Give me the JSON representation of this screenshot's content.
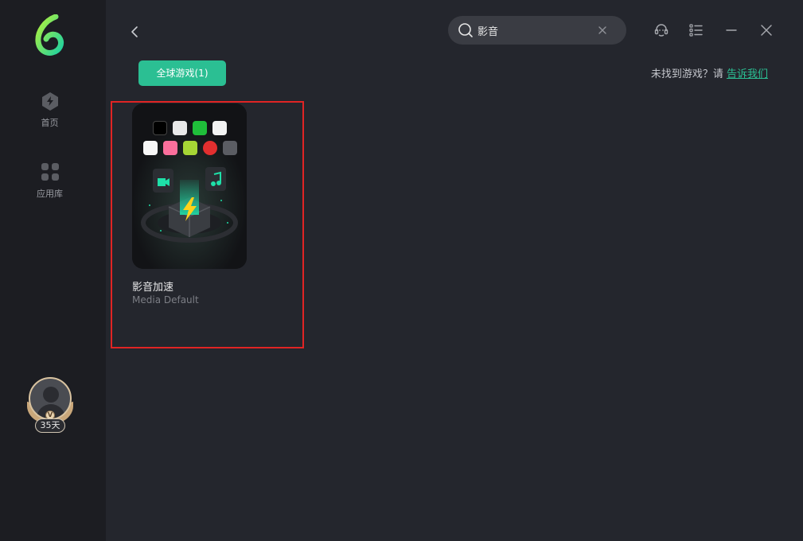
{
  "sidebar": {
    "items": [
      {
        "label": "首页"
      },
      {
        "label": "应用库"
      }
    ],
    "user": {
      "days": "35天",
      "vip_mark": "V"
    }
  },
  "search": {
    "value": "影音",
    "placeholder": ""
  },
  "tabs": [
    {
      "label": "全球游戏(1)"
    }
  ],
  "feedback": {
    "prefix": "未找到游戏？请 ",
    "link": "告诉我们"
  },
  "results": [
    {
      "title": "影音加速",
      "subtitle": "Media Default"
    }
  ],
  "colors": {
    "accent": "#2bbf93",
    "background": "#24262d",
    "sidebar": "#1c1d22",
    "highlight_border": "#e02424"
  },
  "icons": [
    "logo-icon",
    "home-icon",
    "app-library-icon",
    "back-icon",
    "search-icon",
    "clear-icon",
    "support-icon",
    "menu-icon",
    "minimize-icon",
    "close-icon"
  ]
}
